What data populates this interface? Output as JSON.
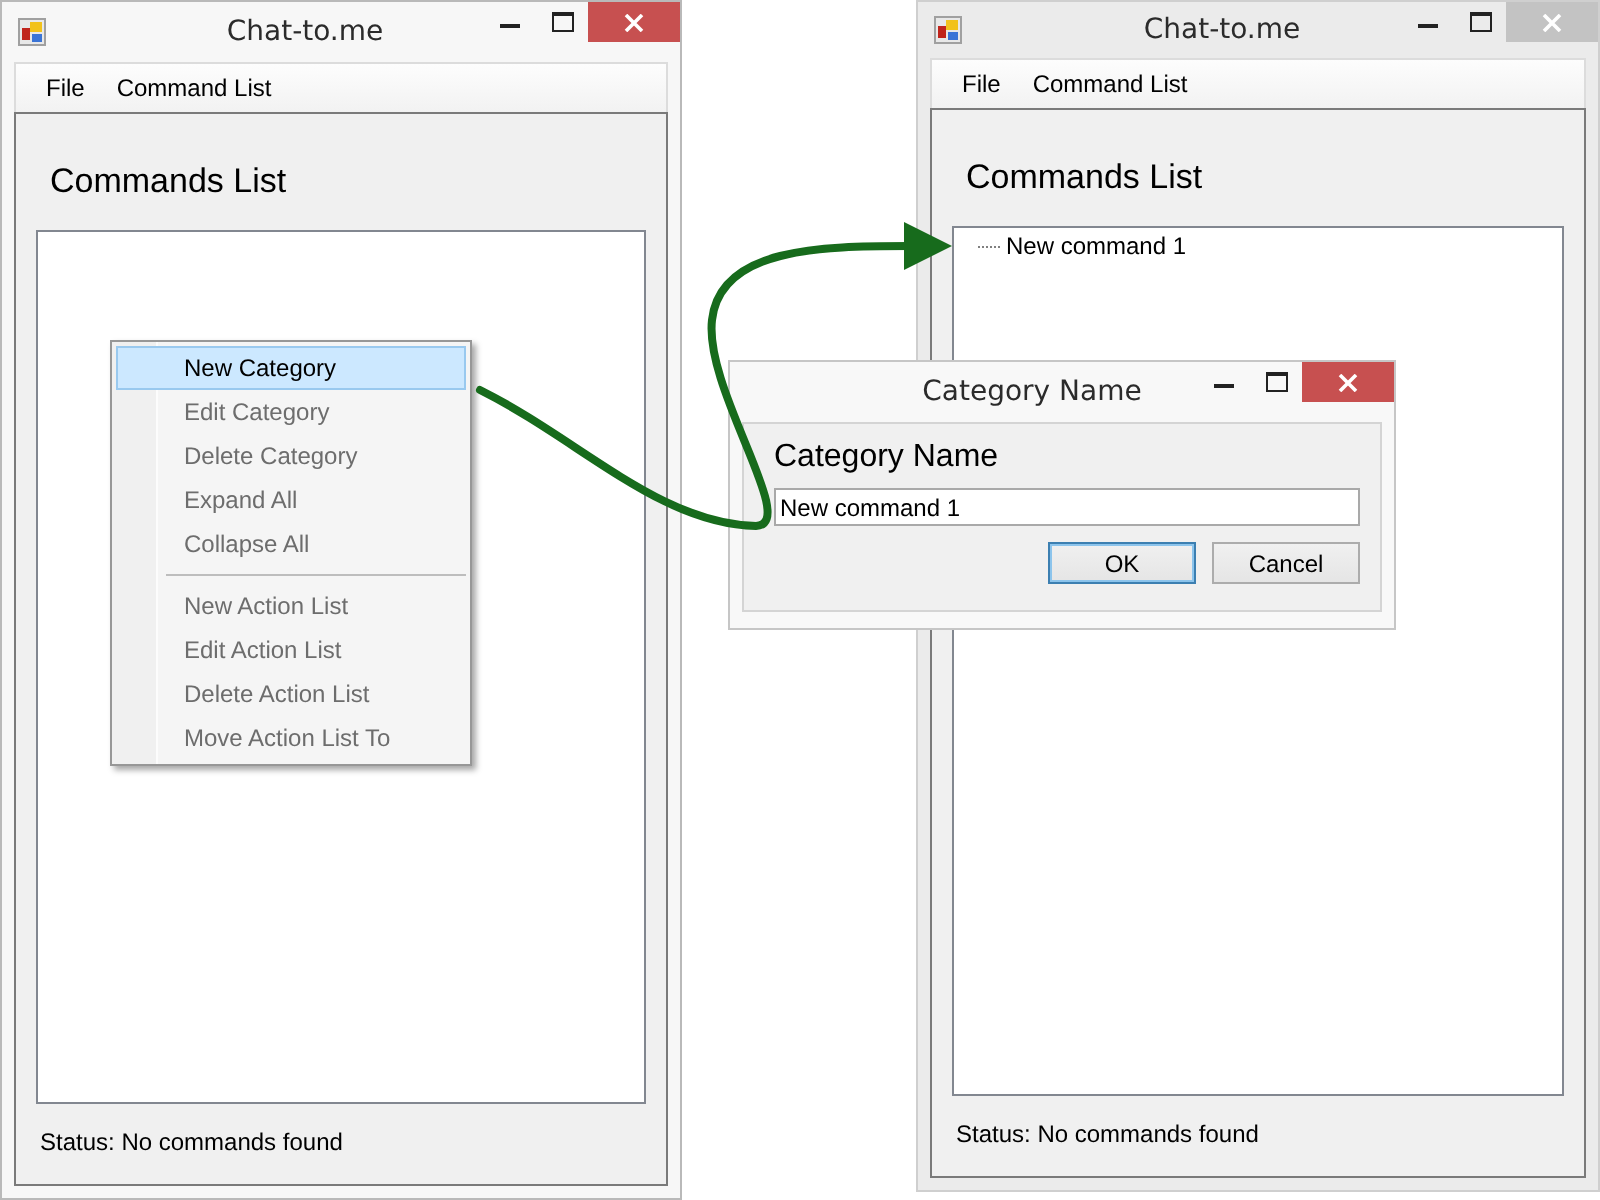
{
  "windows": [
    {
      "title": "Chat-to.me",
      "active": true,
      "menu": [
        "File",
        "Command List"
      ],
      "heading": "Commands List",
      "status": "Status: No commands found"
    },
    {
      "title": "Chat-to.me",
      "active": false,
      "menu": [
        "File",
        "Command List"
      ],
      "heading": "Commands List",
      "tree": [
        {
          "label": "New command 1"
        }
      ],
      "status": "Status: No commands found"
    }
  ],
  "context_menu": {
    "groups": [
      [
        {
          "label": "New Category",
          "selected": true,
          "disabled": false
        },
        {
          "label": "Edit Category",
          "selected": false,
          "disabled": true
        },
        {
          "label": "Delete Category",
          "selected": false,
          "disabled": true
        },
        {
          "label": "Expand All",
          "selected": false,
          "disabled": true
        },
        {
          "label": "Collapse All",
          "selected": false,
          "disabled": true
        }
      ],
      [
        {
          "label": "New Action List",
          "selected": false,
          "disabled": true
        },
        {
          "label": "Edit Action List",
          "selected": false,
          "disabled": true
        },
        {
          "label": "Delete Action List",
          "selected": false,
          "disabled": true
        },
        {
          "label": "Move Action List To",
          "selected": false,
          "disabled": true
        }
      ]
    ]
  },
  "dialog": {
    "title": "Category Name",
    "active": true,
    "label": "Category Name",
    "value": "New command 1",
    "buttons": [
      {
        "label": "OK",
        "default": true
      },
      {
        "label": "Cancel",
        "default": false
      }
    ]
  }
}
